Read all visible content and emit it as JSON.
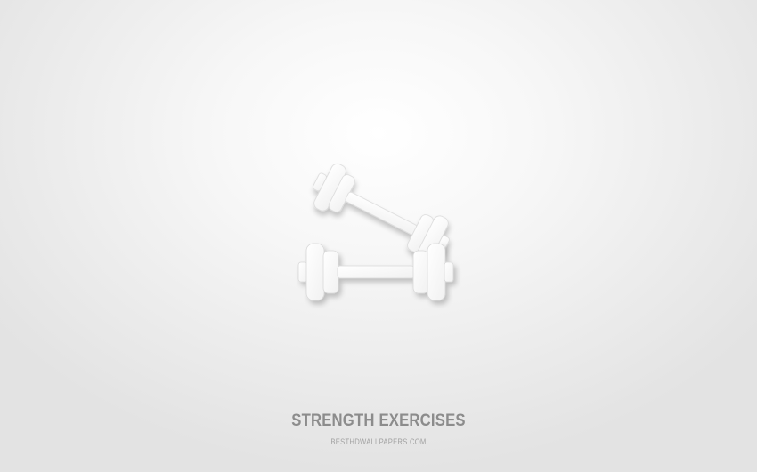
{
  "title": "STRENGTH EXERCISES",
  "watermark": "BESTHDWALLPAPERS.COM",
  "icon": "dumbbells-icon",
  "colors": {
    "background": "#efefef",
    "icon": "#ffffff",
    "title": "#8c8c8c",
    "watermark": "#a2a2a2"
  }
}
